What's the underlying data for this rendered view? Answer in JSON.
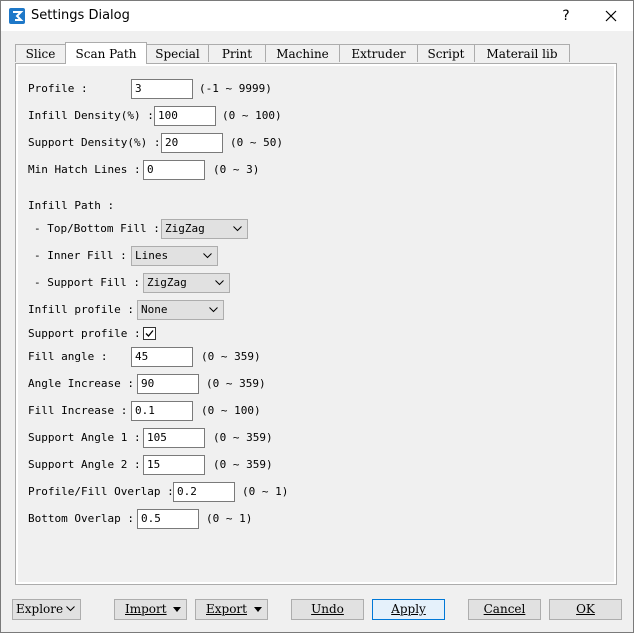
{
  "window": {
    "title": "Settings Dialog",
    "help": "?"
  },
  "tabs": [
    "Slice",
    "Scan Path",
    "Special",
    "Print",
    "Machine",
    "Extruder",
    "Script",
    "Materail lib"
  ],
  "form": {
    "profile": {
      "label": "Profile :",
      "value": "3",
      "range": "(-1 ~ 9999)"
    },
    "infill_density": {
      "label": "Infill Density(%) :",
      "value": "100",
      "range": "(0 ~ 100)"
    },
    "support_density": {
      "label": "Support Density(%) :",
      "value": "20",
      "range": "(0 ~ 50)"
    },
    "min_hatch": {
      "label": "Min Hatch Lines :",
      "value": "0",
      "range": "(0 ~ 3)"
    },
    "infill_path": {
      "label": "Infill Path :"
    },
    "top_bottom_fill": {
      "label": "- Top/Bottom Fill :",
      "value": "ZigZag"
    },
    "inner_fill": {
      "label": "- Inner Fill :",
      "value": "Lines"
    },
    "support_fill": {
      "label": "- Support Fill :",
      "value": "ZigZag"
    },
    "infill_profile": {
      "label": "Infill profile :",
      "value": "None"
    },
    "support_profile": {
      "label": "Support profile :",
      "checked": true
    },
    "fill_angle": {
      "label": "Fill angle :",
      "value": "45",
      "range": "(0 ~ 359)"
    },
    "angle_increase": {
      "label": "Angle Increase :",
      "value": "90",
      "range": "(0 ~ 359)"
    },
    "fill_increase": {
      "label": "Fill Increase :",
      "value": "0.1",
      "range": "(0 ~ 100)"
    },
    "support_angle_1": {
      "label": "Support Angle 1 :",
      "value": "105",
      "range": "(0 ~ 359)"
    },
    "support_angle_2": {
      "label": "Support Angle 2 :",
      "value": "15",
      "range": "(0 ~ 359)"
    },
    "profile_fill_overlap": {
      "label": "Profile/Fill Overlap :",
      "value": "0.2",
      "range": "(0 ~ 1)"
    },
    "bottom_overlap": {
      "label": "Bottom Overlap :",
      "value": "0.5",
      "range": "(0 ~ 1)"
    }
  },
  "buttons": {
    "explore": "Explore",
    "import": "Import",
    "export": "Export",
    "undo": "Undo",
    "apply": "Apply",
    "cancel": "Cancel",
    "ok": "OK"
  }
}
